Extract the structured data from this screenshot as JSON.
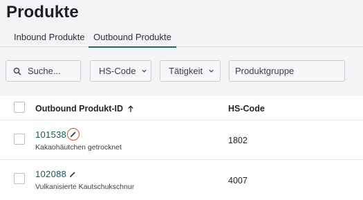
{
  "page": {
    "title": "Produkte"
  },
  "tabs": [
    {
      "label": "Inbound Produkte",
      "active": false
    },
    {
      "label": "Outbound Produkte",
      "active": true
    }
  ],
  "filters": {
    "search_placeholder": "Suche...",
    "hs_code_label": "HS-Code",
    "activity_label": "Tätigkeit",
    "product_group_placeholder": "Produktgruppe"
  },
  "table": {
    "columns": [
      "Outbound Produkt-ID",
      "HS-Code"
    ],
    "sort_direction": "ascending",
    "rows": [
      {
        "id": "101538",
        "description": "Kakaohäutchen getrocknet",
        "hs_code": "1802"
      },
      {
        "id": "102088",
        "description": "Vulkanisierte Kautschukschnur",
        "hs_code": "4007"
      }
    ]
  },
  "colors": {
    "accent": "#1e6b63",
    "link": "#165a53",
    "highlight_ring": "#d5502e",
    "background": "#f4f4f6"
  },
  "icons": {
    "search": "search-icon",
    "dropdown": "chevron-down-icon",
    "sort": "arrow-up-icon",
    "edit": "pencil-icon"
  }
}
